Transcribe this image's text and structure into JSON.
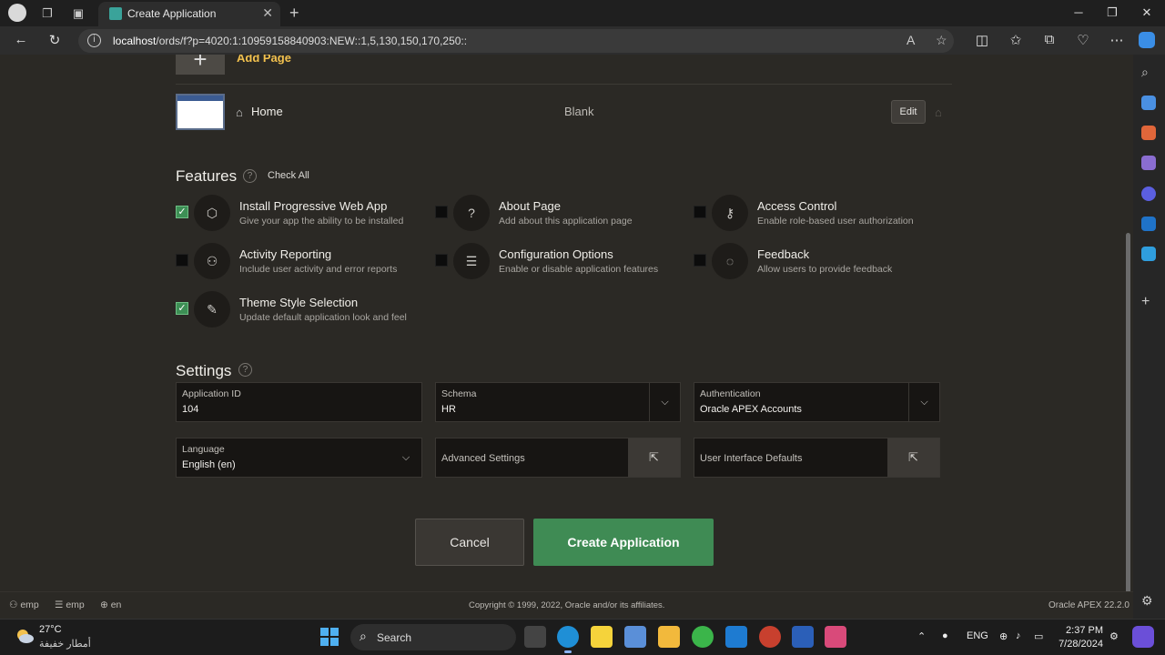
{
  "browser": {
    "tab_title": "Create Application",
    "url_host": "localhost",
    "url_path": "/ords/f?p=4020:1:10959158840903:NEW::1,5,130,150,170,250::"
  },
  "pages": {
    "add_page_label": "Add Page",
    "home_label": "Home",
    "home_type": "Blank",
    "edit_label": "Edit"
  },
  "features": {
    "title": "Features",
    "help": "?",
    "check_all": "Check All",
    "items": [
      {
        "title": "Install Progressive Web App",
        "desc": "Give your app the ability to be installed",
        "checked": true,
        "icon": "box-icon"
      },
      {
        "title": "About Page",
        "desc": "Add about this application page",
        "checked": false,
        "icon": "question-icon"
      },
      {
        "title": "Access Control",
        "desc": "Enable role-based user authorization",
        "checked": false,
        "icon": "key-icon"
      },
      {
        "title": "Activity Reporting",
        "desc": "Include user activity and error reports",
        "checked": false,
        "icon": "user-chart-icon"
      },
      {
        "title": "Configuration Options",
        "desc": "Enable or disable application features",
        "checked": false,
        "icon": "sliders-icon"
      },
      {
        "title": "Feedback",
        "desc": "Allow users to provide feedback",
        "checked": false,
        "icon": "speech-bubble-icon"
      },
      {
        "title": "Theme Style Selection",
        "desc": "Update default application look and feel",
        "checked": true,
        "icon": "brush-icon"
      }
    ]
  },
  "settings": {
    "title": "Settings",
    "application_id_label": "Application ID",
    "application_id_value": "104",
    "schema_label": "Schema",
    "schema_value": "HR",
    "authentication_label": "Authentication",
    "authentication_value": "Oracle APEX Accounts",
    "language_label": "Language",
    "language_value": "English (en)",
    "advanced_settings_label": "Advanced Settings",
    "ui_defaults_label": "User Interface Defaults"
  },
  "actions": {
    "cancel_label": "Cancel",
    "create_label": "Create Application"
  },
  "footer": {
    "user": "emp",
    "schema": "emp",
    "lang": "en",
    "copyright": "Copyright © 1999, 2022, Oracle and/or its affiliates.",
    "version": "Oracle APEX 22.2.0"
  },
  "taskbar": {
    "temp": "27°C",
    "condition": "أمطار خفيفة",
    "search_label": "Search",
    "lang": "ENG",
    "time": "2:37 PM",
    "date": "7/28/2024"
  }
}
